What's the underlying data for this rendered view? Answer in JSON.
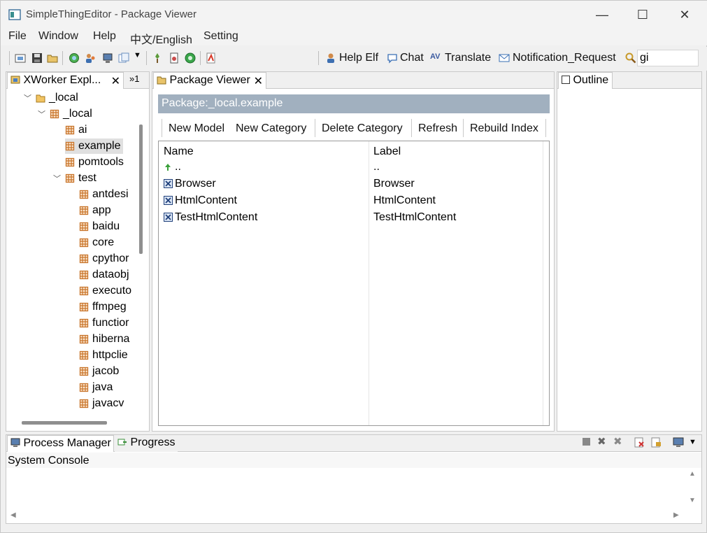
{
  "window": {
    "title": "SimpleThingEditor - Package Viewer",
    "controls": {
      "minimize": "—",
      "maximize": "☐",
      "close": "✕"
    }
  },
  "menu": [
    "File",
    "Window",
    "Help",
    "中文/English",
    "Setting"
  ],
  "toolbar": {
    "help_elf": "Help Elf",
    "chat": "Chat",
    "translate": "Translate",
    "notification": "Notification_Request",
    "search_value": "gi"
  },
  "explorer": {
    "tab_label": "XWorker Expl...",
    "overflow_label": "»1",
    "tree": [
      {
        "label": "_local",
        "level": 0,
        "expanded": true,
        "icon": "folder-icon"
      },
      {
        "label": "_local",
        "level": 1,
        "expanded": true,
        "icon": "package-icon"
      },
      {
        "label": "ai",
        "level": 2,
        "icon": "package-icon"
      },
      {
        "label": "example",
        "level": 2,
        "icon": "package-icon",
        "selected": true
      },
      {
        "label": "pomtools",
        "level": 2,
        "icon": "package-icon"
      },
      {
        "label": "test",
        "level": 2,
        "expanded": true,
        "icon": "package-icon"
      },
      {
        "label": "antdesi",
        "level": 3,
        "icon": "package-icon"
      },
      {
        "label": "app",
        "level": 3,
        "icon": "package-icon"
      },
      {
        "label": "baidu",
        "level": 3,
        "icon": "package-icon"
      },
      {
        "label": "core",
        "level": 3,
        "icon": "package-icon"
      },
      {
        "label": "cpythor",
        "level": 3,
        "icon": "package-icon"
      },
      {
        "label": "dataobj",
        "level": 3,
        "icon": "package-icon"
      },
      {
        "label": "executo",
        "level": 3,
        "icon": "package-icon"
      },
      {
        "label": "ffmpeg",
        "level": 3,
        "icon": "package-icon"
      },
      {
        "label": "functior",
        "level": 3,
        "icon": "package-icon"
      },
      {
        "label": "hiberna",
        "level": 3,
        "icon": "package-icon"
      },
      {
        "label": "httpclie",
        "level": 3,
        "icon": "package-icon"
      },
      {
        "label": "jacob",
        "level": 3,
        "icon": "package-icon"
      },
      {
        "label": "java",
        "level": 3,
        "icon": "package-icon"
      },
      {
        "label": "javacv",
        "level": 3,
        "icon": "package-icon"
      }
    ]
  },
  "package_viewer": {
    "tab_label": "Package Viewer",
    "header": "Package:_local.example",
    "actions": [
      "New Model",
      "New Category",
      "Delete Category",
      "Refresh",
      "Rebuild Index"
    ],
    "columns": [
      "Name",
      "Label"
    ],
    "rows": [
      {
        "name": "..",
        "label": "..",
        "icon": "up-arrow-icon"
      },
      {
        "name": "Browser",
        "label": "Browser",
        "icon": "model-icon"
      },
      {
        "name": "HtmlContent",
        "label": "HtmlContent",
        "icon": "model-icon"
      },
      {
        "name": "TestHtmlContent",
        "label": "TestHtmlContent",
        "icon": "model-icon"
      }
    ]
  },
  "outline": {
    "tab_label": "Outline"
  },
  "bottom": {
    "tabs": [
      "Process Manager",
      "Progress"
    ],
    "console_title": "System Console"
  },
  "colors": {
    "header_bar": "#a1b0bf",
    "selection": "#e0e0e0",
    "package_icon": "#c8742a"
  }
}
